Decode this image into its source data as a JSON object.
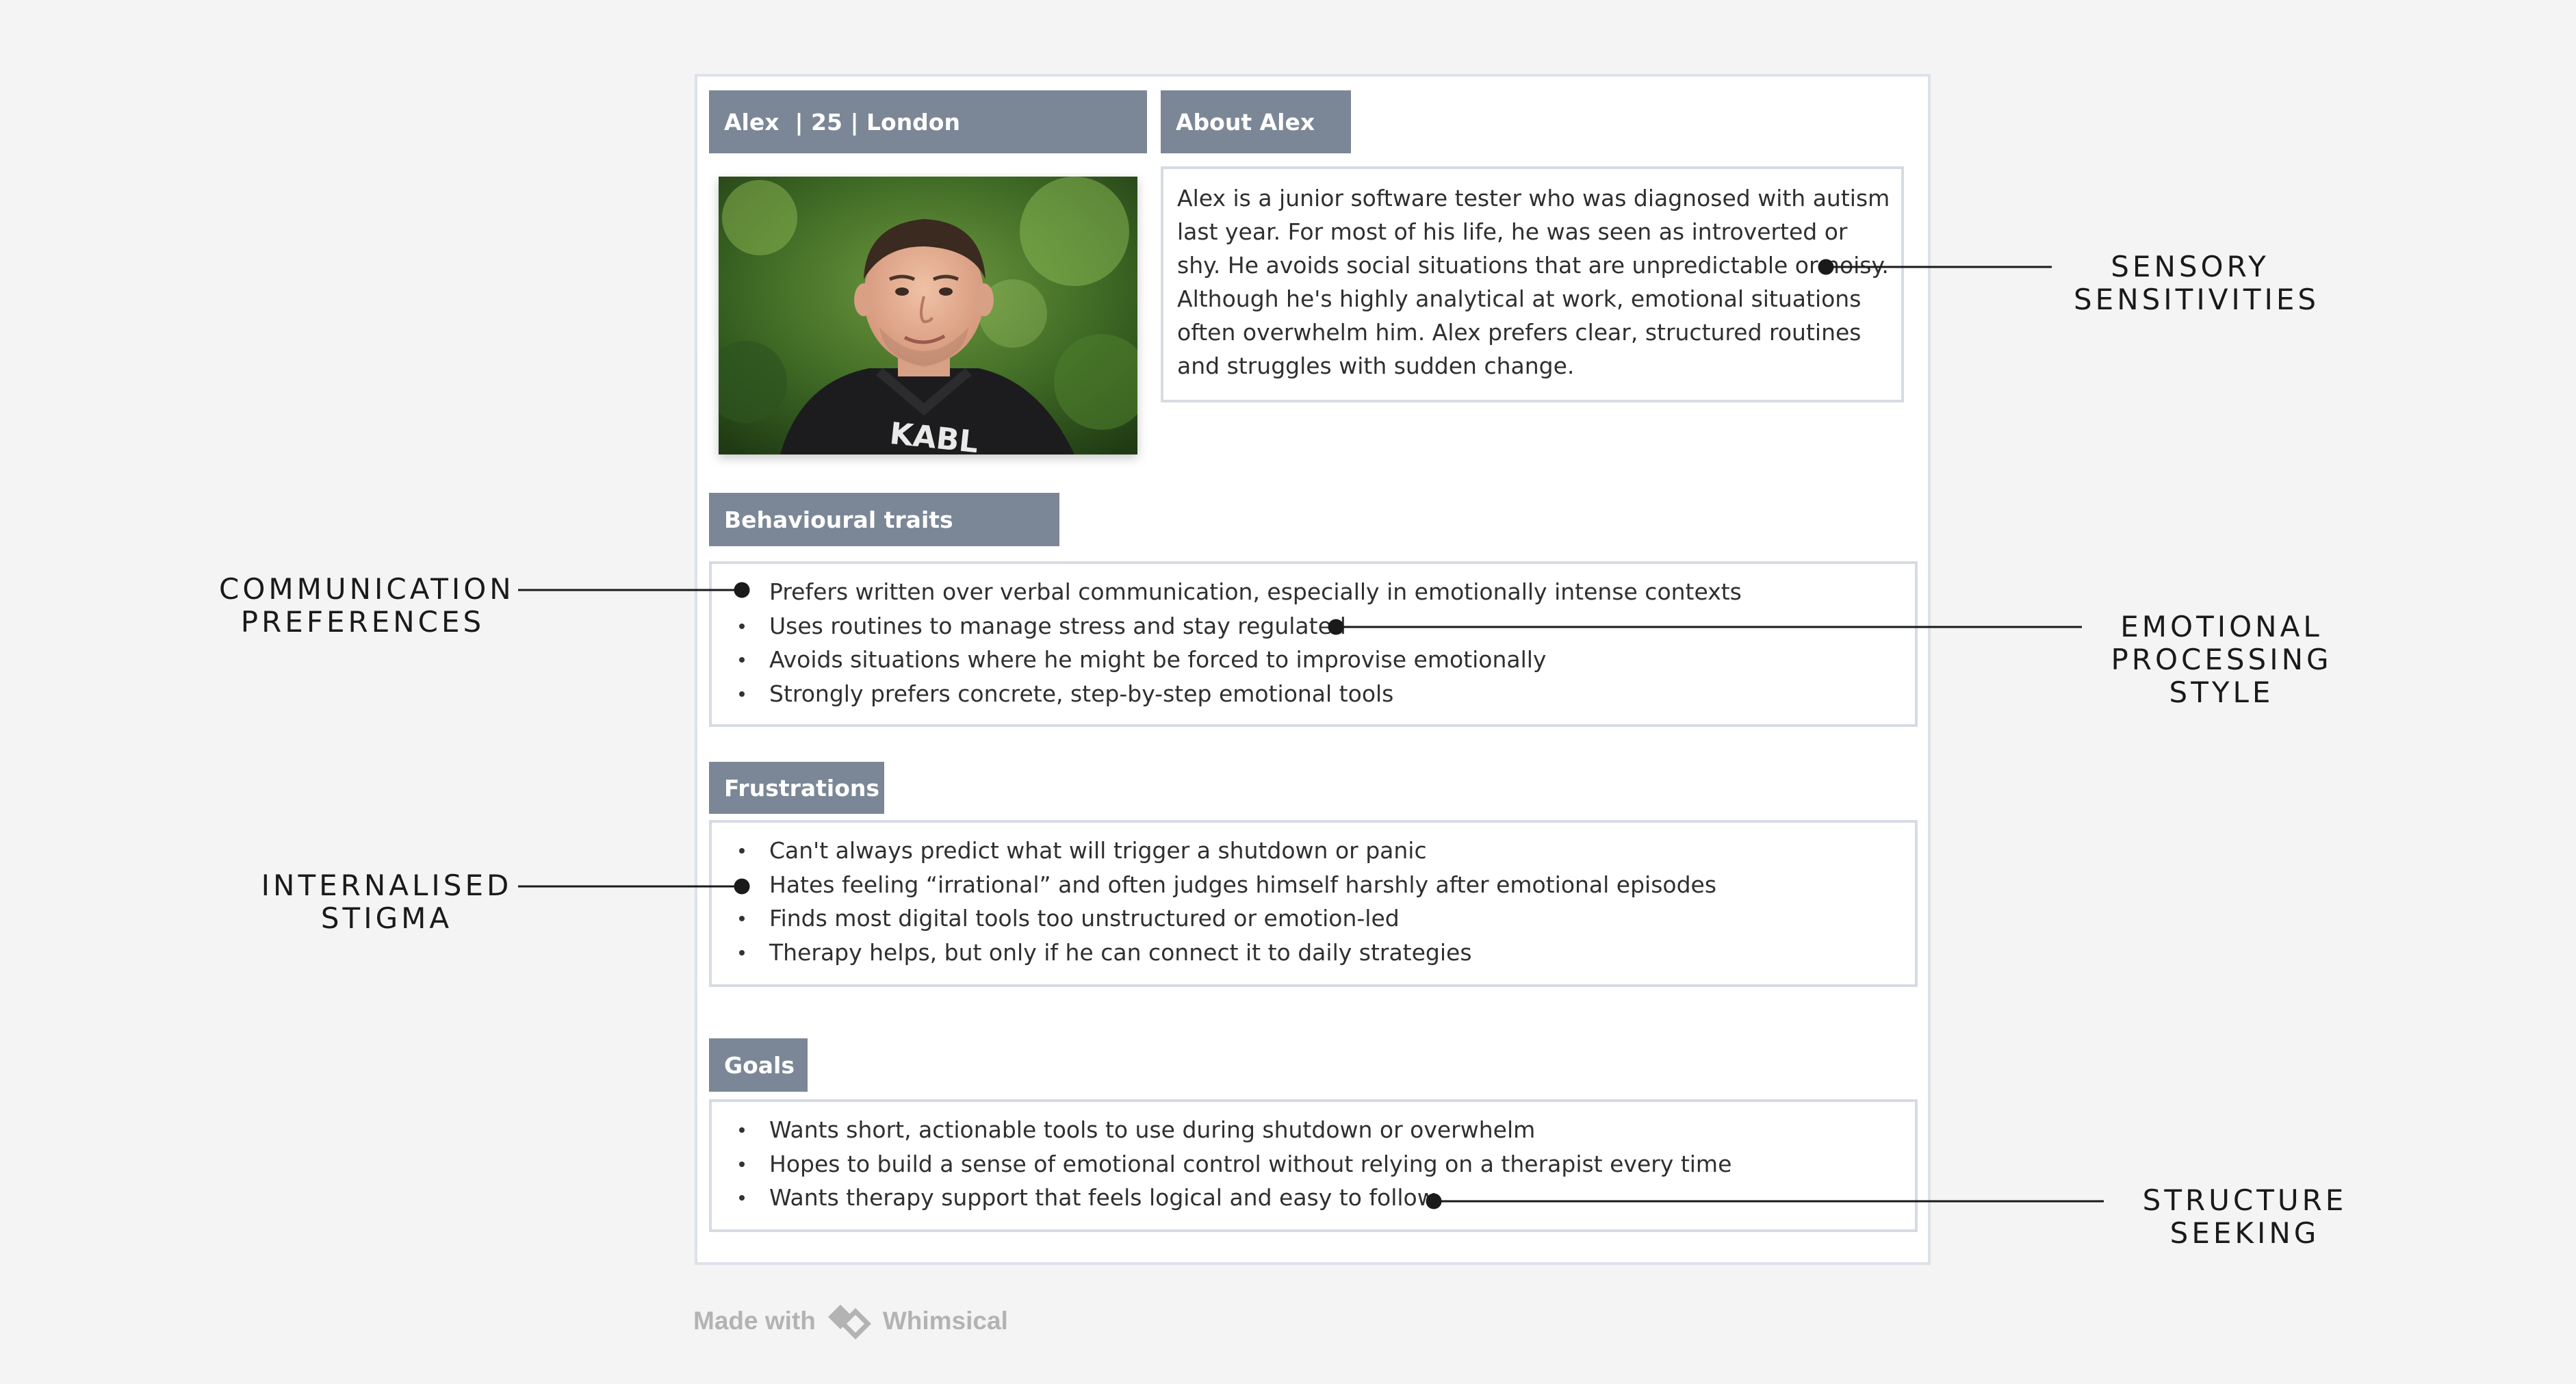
{
  "persona": {
    "header": "Alex  | 25 | London",
    "about_header": "About Alex",
    "about_text": "Alex is a junior software tester who was diagnosed with autism last year. For most of his life, he was seen as introverted or shy. He avoids social situations that are unpredictable or noisy. Although he's highly analytical at work, emotional situations often overwhelm him. Alex prefers clear, structured routines and struggles with sudden change."
  },
  "sections": {
    "behavioural": {
      "title": "Behavioural traits",
      "items": [
        "Prefers written over verbal communication, especially in emotionally intense contexts",
        "Uses routines to manage stress and stay regulated",
        "Avoids situations where he might be forced to improvise emotionally",
        "Strongly prefers concrete, step-by-step emotional tools"
      ]
    },
    "frustrations": {
      "title": "Frustrations",
      "items": [
        "Can't always predict what will trigger a shutdown or panic",
        "Hates feeling “irrational” and often judges himself harshly after emotional episodes",
        "Finds most digital tools too unstructured or emotion-led",
        "Therapy helps, but only if he can connect it to daily strategies"
      ]
    },
    "goals": {
      "title": "Goals",
      "items": [
        "Wants short, actionable tools to use during shutdown or overwhelm",
        "Hopes to build a sense of emotional control without relying on a therapist every time",
        "Wants therapy support that feels logical and easy to follow"
      ]
    }
  },
  "callouts": {
    "sensory": [
      "SENSORY",
      "SENSITIVITIES"
    ],
    "communication": [
      "COMMUNICATION",
      "PREFERENCES"
    ],
    "emotional": [
      "EMOTIONAL",
      "PROCESSING",
      "STYLE"
    ],
    "stigma": [
      "INTERNALISED",
      "STIGMA"
    ],
    "structure": [
      "STRUCTURE",
      "SEEKING"
    ]
  },
  "footer": {
    "made_with": "Made with",
    "brand": "Whimsical"
  },
  "colors": {
    "header_bg": "#7b8796",
    "border": "#d6dbe3",
    "page_bg": "#f4f4f4",
    "connector": "#1a1a1a"
  }
}
